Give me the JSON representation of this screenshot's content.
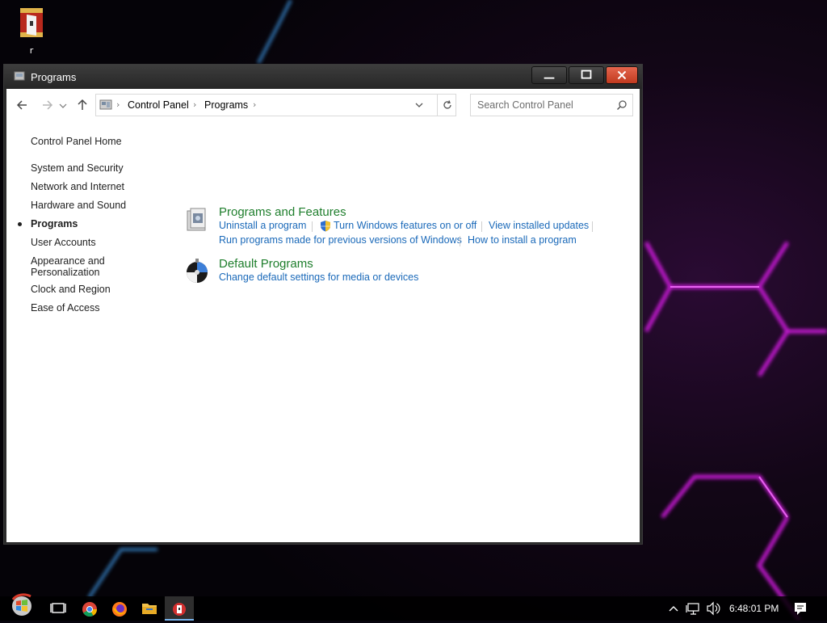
{
  "desktop": {
    "icon_label": "r"
  },
  "window": {
    "title": "Programs",
    "icon": "programs-icon"
  },
  "address_bar": {
    "crumbs": [
      "Control Panel",
      "Programs"
    ],
    "search_placeholder": "Search Control Panel"
  },
  "left_nav": {
    "home": "Control Panel Home",
    "items": [
      "System and Security",
      "Network and Internet",
      "Hardware and Sound",
      "Programs",
      "User Accounts",
      "Appearance and Personalization",
      "Clock and Region",
      "Ease of Access"
    ],
    "appearance_line1": "Appearance and",
    "appearance_line2": "Personalization",
    "active": "Programs"
  },
  "categories": {
    "programs_features": {
      "title": "Programs and Features",
      "links": [
        "Uninstall a program",
        "Turn Windows features on or off",
        "View installed updates",
        "Run programs made for previous versions of Windows",
        "How to install a program"
      ]
    },
    "default_programs": {
      "title": "Default Programs",
      "links": [
        "Change default settings for media or devices"
      ]
    }
  },
  "taskbar": {
    "apps": [
      "start-orb-icon",
      "task-view-icon",
      "chrome-icon",
      "firefox-icon",
      "file-explorer-icon",
      "control-panel-icon"
    ],
    "clock": "6:48:01 PM"
  },
  "colors": {
    "link": "#1a69b9",
    "category_title": "#1e7e2c",
    "close_button": "#c8432a",
    "accent_glow": "#c026d3"
  }
}
